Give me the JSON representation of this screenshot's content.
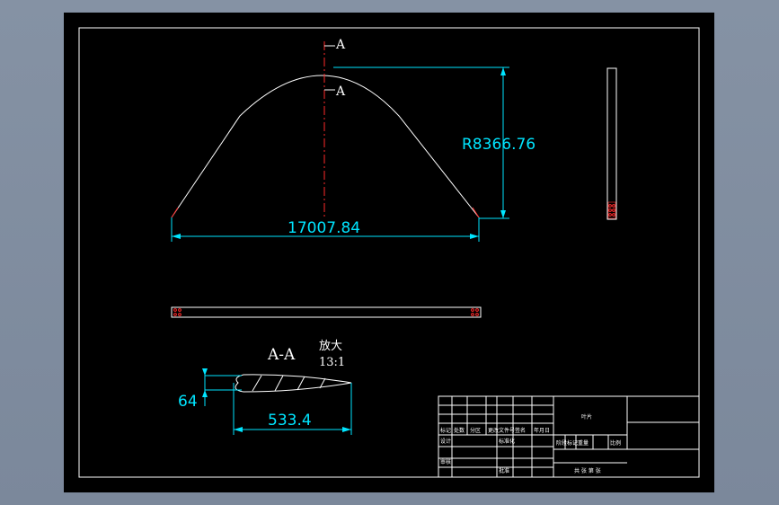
{
  "drawing": {
    "section_label_top": "A",
    "section_label_bottom": "A",
    "radius_dim": "R8366.76",
    "length_dim": "17007.84",
    "section_title": "A-A",
    "scale_title": "放大",
    "scale_value": "13:1",
    "thickness_dim": "64",
    "chord_dim": "533.4"
  },
  "title_block": {
    "part_name": "叶片",
    "labels": {
      "mark": "标记",
      "count": "处数",
      "zone": "分区",
      "change_doc": "更改文件号",
      "signature": "签名",
      "date": "年月日",
      "designer": "设计",
      "standardize": "标准化",
      "stage_mark": "阶段标记",
      "weight": "重量",
      "scale": "比例",
      "checker": "审核",
      "approve": "批准",
      "sheets": "共 张 第 张"
    }
  },
  "colors": {
    "background": "#000000",
    "outer": "#7b889b",
    "geometry": "#ffffff",
    "dimension": "#00e5ff",
    "centerline": "#ff2a2a"
  }
}
